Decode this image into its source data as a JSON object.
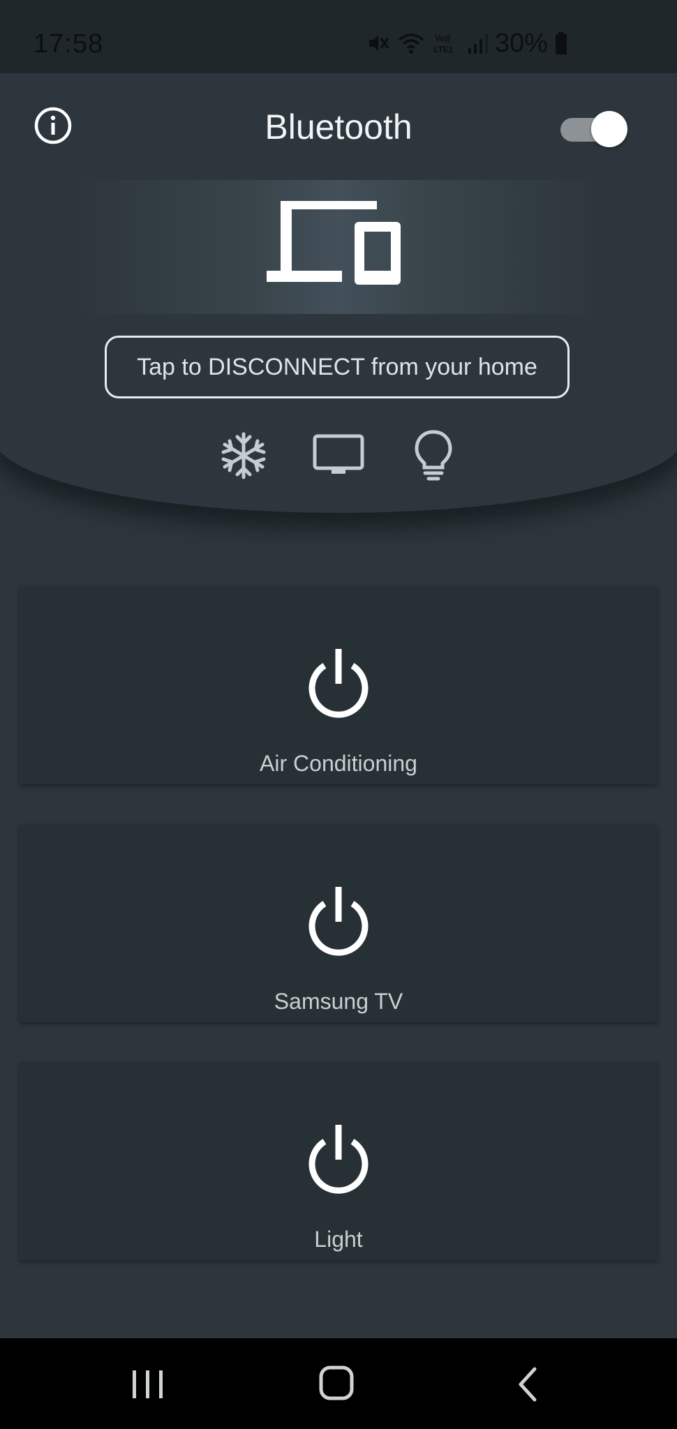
{
  "status_bar": {
    "time": "17:58",
    "battery_percent": "30%",
    "icons": [
      "mute-icon",
      "wifi-icon",
      "volte-lte-icon",
      "signal-icon",
      "battery-icon"
    ]
  },
  "header": {
    "title": "Bluetooth",
    "bluetooth_toggle_on": true,
    "disconnect_label": "Tap to DISCONNECT from your home",
    "quick_icons": [
      "snowflake-icon",
      "tv-icon",
      "lightbulb-icon"
    ]
  },
  "devices": [
    {
      "name": "Air Conditioning"
    },
    {
      "name": "Samsung TV"
    },
    {
      "name": "Light"
    }
  ],
  "nav_bar": {
    "buttons": [
      "recents-button",
      "home-button",
      "back-button"
    ]
  },
  "colors": {
    "background": "#2c363c",
    "card": "#273035",
    "status_bar": "#1f272b",
    "text": "#e9ecee"
  }
}
